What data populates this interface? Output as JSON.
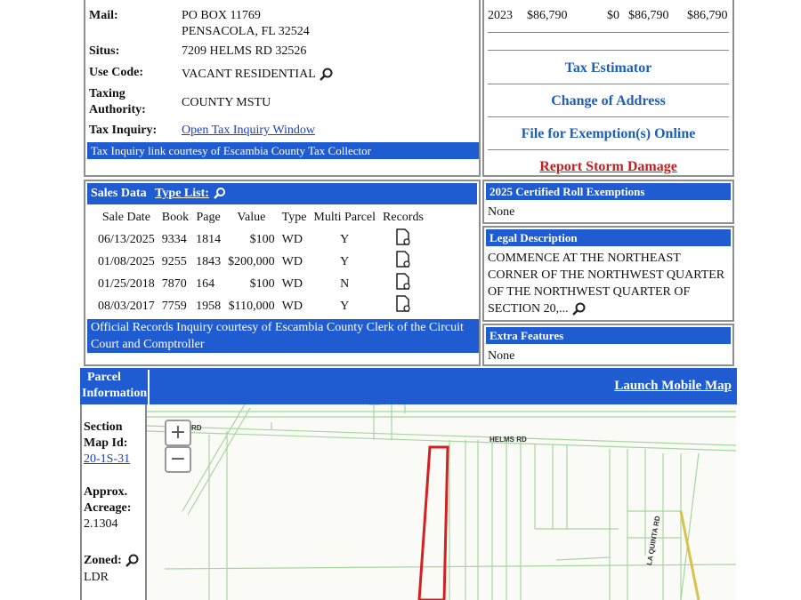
{
  "owner": {
    "mail_label": "Mail:",
    "mail_line1": "PO BOX 11769",
    "mail_line2": "PENSACOLA, FL 32524",
    "situs_label": "Situs:",
    "situs_value": "7209 HELMS RD 32526",
    "use_code_label": "Use Code:",
    "use_code_value": "VACANT RESIDENTIAL",
    "taxing_label_1": "Taxing",
    "taxing_label_2": "Authority:",
    "taxing_value": "COUNTY MSTU",
    "tax_inquiry_label": "Tax Inquiry:",
    "tax_inquiry_link": "Open Tax Inquiry Window",
    "tax_inquiry_note": "Tax Inquiry link courtesy of Escambia County Tax Collector"
  },
  "assessment": {
    "year": "2023",
    "land": "$86,790",
    "imprv": "$0",
    "total": "$86,790",
    "cap_val": "$86,790"
  },
  "side_links": [
    "Tax Estimator",
    "Change of Address",
    "File for Exemption(s) Online",
    "Report Storm Damage"
  ],
  "sales": {
    "title": "Sales Data",
    "type_list": "Type List:",
    "columns": [
      "Sale Date",
      "Book",
      "Page",
      "Value",
      "Type",
      "Multi Parcel",
      "Records"
    ],
    "rows": [
      [
        "06/13/2025",
        "9334",
        "1814",
        "$100",
        "WD",
        "Y"
      ],
      [
        "01/08/2025",
        "9255",
        "1843",
        "$200,000",
        "WD",
        "Y"
      ],
      [
        "01/25/2018",
        "7870",
        "164",
        "$100",
        "WD",
        "N"
      ],
      [
        "08/03/2017",
        "7759",
        "1958",
        "$110,000",
        "WD",
        "Y"
      ]
    ],
    "note": "Official Records Inquiry courtesy of Escambia County Clerk of the Circuit Court and Comptroller"
  },
  "exemptions": {
    "title": "2025 Certified Roll Exemptions",
    "value": "None"
  },
  "legal": {
    "title": "Legal Description",
    "text": "COMMENCE AT THE NORTHEAST CORNER OF THE NORTHWEST QUARTER OF THE NORTHWEST QUARTER OF SECTION 20,..."
  },
  "extra": {
    "title": "Extra Features",
    "value": "None"
  },
  "parcel": {
    "title_1": "Parcel",
    "title_2": "Information",
    "launch_map": "Launch Mobile Map",
    "section_label_1": "Section",
    "section_label_2": "Map Id:",
    "section_value": "20-1S-31",
    "acreage_label_1": "Approx.",
    "acreage_label_2": "Acreage:",
    "acreage_value": "2.1304",
    "zoned_label": "Zoned:",
    "zoned_value": "LDR"
  },
  "map": {
    "road_label": "HELMS RD",
    "road_label_2": "LA QUINTA RD",
    "zoom_in": "+",
    "zoom_out": "−",
    "rd_fragment": "RD"
  },
  "colors": {
    "header_blue": "#1f5bd1",
    "link_blue": "#1e5fb5",
    "report_red": "#c41e1e",
    "parcel_red": "#d42020"
  }
}
